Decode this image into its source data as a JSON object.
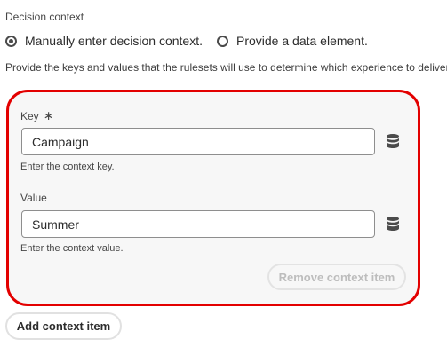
{
  "section_label": "Decision context",
  "radio_options": [
    {
      "label": "Manually enter decision context.",
      "checked": true
    },
    {
      "label": "Provide a data element.",
      "checked": false
    }
  ],
  "description": "Provide the keys and values that the rulesets will use to determine which experience to deliver.",
  "context_item": {
    "key": {
      "label": "Key",
      "required_marker": "∗",
      "value": "Campaign",
      "help_text": "Enter the context key.",
      "icon": "database-icon"
    },
    "value": {
      "label": "Value",
      "value": "Summer",
      "help_text": "Enter the context value.",
      "icon": "database-icon"
    },
    "remove_button_label": "Remove context item",
    "remove_button_disabled": true,
    "highlight_color": "#e30000"
  },
  "add_button_label": "Add context item"
}
